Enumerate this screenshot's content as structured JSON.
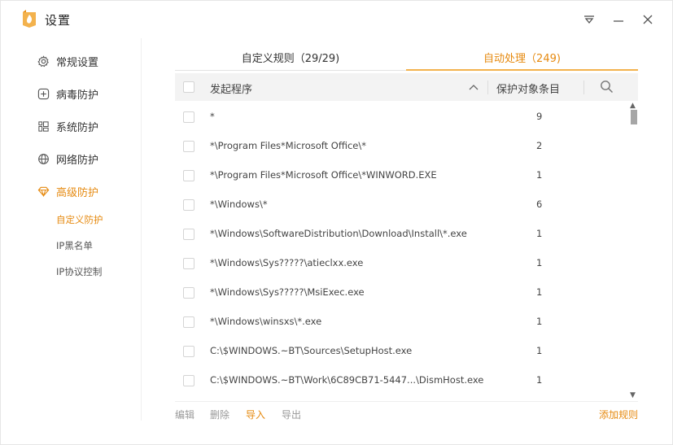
{
  "window": {
    "title": "设置"
  },
  "colors": {
    "accent": "#e68a10",
    "accent_light": "#f3b24d",
    "header_bg": "#f3f3f3"
  },
  "sidebar": {
    "items": [
      {
        "label": "常规设置",
        "icon": "gear-icon"
      },
      {
        "label": "病毒防护",
        "icon": "plus-square-icon"
      },
      {
        "label": "系统防护",
        "icon": "grid-icon"
      },
      {
        "label": "网络防护",
        "icon": "globe-icon"
      },
      {
        "label": "高级防护",
        "icon": "diamond-icon",
        "active": true
      }
    ],
    "subitems": [
      {
        "label": "自定义防护",
        "active": true
      },
      {
        "label": "IP黑名单"
      },
      {
        "label": "IP协议控制"
      }
    ]
  },
  "tabs": [
    {
      "label": "自定义规则（29/29)"
    },
    {
      "label": "自动处理（249)",
      "active": true
    }
  ],
  "table": {
    "headers": {
      "program": "发起程序",
      "count": "保护对象条目"
    },
    "rows": [
      {
        "path": "*",
        "count": "9"
      },
      {
        "path": "*\\Program Files*Microsoft Office\\*",
        "count": "2"
      },
      {
        "path": "*\\Program Files*Microsoft Office\\*WINWORD.EXE",
        "count": "1"
      },
      {
        "path": "*\\Windows\\*",
        "count": "6"
      },
      {
        "path": "*\\Windows\\SoftwareDistribution\\Download\\Install\\*.exe",
        "count": "1"
      },
      {
        "path": "*\\Windows\\Sys?????\\atieclxx.exe",
        "count": "1"
      },
      {
        "path": "*\\Windows\\Sys?????\\MsiExec.exe",
        "count": "1"
      },
      {
        "path": "*\\Windows\\winsxs\\*.exe",
        "count": "1"
      },
      {
        "path": "C:\\$WINDOWS.~BT\\Sources\\SetupHost.exe",
        "count": "1"
      },
      {
        "path": "C:\\$WINDOWS.~BT\\Work\\6C89CB71-5447...\\DismHost.exe",
        "count": "1"
      }
    ]
  },
  "footer": {
    "edit": "编辑",
    "delete": "删除",
    "import": "导入",
    "export": "导出",
    "add_rule": "添加规则"
  }
}
